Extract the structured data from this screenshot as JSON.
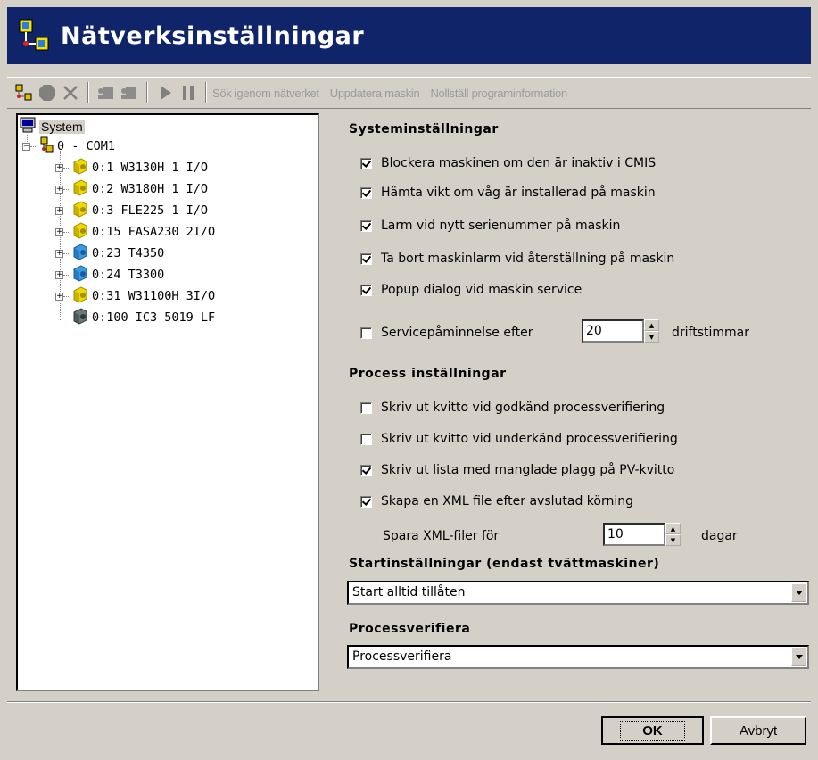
{
  "window": {
    "title": "Nätverksinställningar",
    "title_bar_color": "#0f2469"
  },
  "toolbar": {
    "icons": [
      "network-icon",
      "stop-icon",
      "delete-icon",
      "machine-add-icon",
      "machine-remove-icon",
      "play-icon",
      "pause-icon"
    ],
    "links": [
      "Sök igenom nätverket",
      "Uppdatera maskin",
      "Nollställ programinformation"
    ]
  },
  "tree": {
    "root": "System",
    "port": "0 - COM1",
    "machines": [
      {
        "label": "0:1 W3130H 1 I/O",
        "icon": "yellow-machine-icon"
      },
      {
        "label": "0:2 W3180H 1 I/O",
        "icon": "yellow-machine-icon"
      },
      {
        "label": "0:3 FLE225 1 I/O",
        "icon": "yellow-machine-icon"
      },
      {
        "label": "0:15 FASA230 2I/O",
        "icon": "yellow-machine-icon"
      },
      {
        "label": "0:23 T4350",
        "icon": "blue-machine-icon"
      },
      {
        "label": "0:24 T3300",
        "icon": "blue-machine-icon"
      },
      {
        "label": "0:31 W31100H 3I/O",
        "icon": "yellow-machine-icon"
      },
      {
        "label": "0:100 IC3 5019 LF",
        "icon": "grey-machine-icon"
      }
    ]
  },
  "system_settings": {
    "heading": "Systeminställningar",
    "options": [
      {
        "label": "Blockera maskinen om den är inaktiv i CMIS",
        "checked": true
      },
      {
        "label": "Hämta vikt om våg är installerad på maskin",
        "checked": true
      },
      {
        "label": "Larm vid nytt serienummer på maskin",
        "checked": true
      },
      {
        "label": "Ta bort maskinlarm vid återställning på maskin",
        "checked": true
      },
      {
        "label": "Popup dialog vid maskin service",
        "checked": true
      }
    ],
    "service_reminder": {
      "label": "Servicepåminnelse efter",
      "checked": false,
      "value": "20",
      "unit": "driftstimmar"
    }
  },
  "process_settings": {
    "heading": "Process inställningar",
    "options": [
      {
        "label": "Skriv ut kvitto vid godkänd processverifiering",
        "checked": false
      },
      {
        "label": "Skriv ut kvitto vid underkänd processverifiering",
        "checked": false
      },
      {
        "label": "Skriv ut lista med manglade plagg på PV-kvitto",
        "checked": true
      },
      {
        "label": "Skapa en XML file efter avslutad körning",
        "checked": true
      }
    ],
    "xml_keep": {
      "label": "Spara XML-filer för",
      "value": "10",
      "unit": "dagar"
    }
  },
  "start_settings": {
    "heading": "Startinställningar (endast tvättmaskiner)",
    "selected": "Start alltid tillåten"
  },
  "process_verify": {
    "heading": "Processverifiera",
    "selected": "Processverifiera"
  },
  "buttons": {
    "ok": "OK",
    "cancel": "Avbryt"
  }
}
